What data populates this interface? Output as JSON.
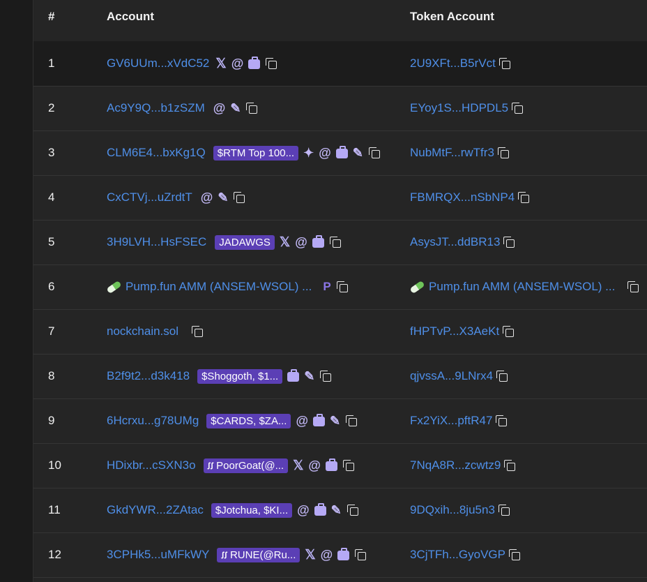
{
  "columns": {
    "num": "#",
    "account": "Account",
    "token": "Token Account"
  },
  "icons": {
    "x": "𝕏",
    "at": "@",
    "p": "P",
    "sparkle": "✦",
    "pencil": "✎",
    "copy": "copy-icon",
    "bag": "briefcase-icon",
    "pill": "pill-icon",
    "tag_prefix": "ꭍꭍ"
  },
  "colors": {
    "link": "#4f8fe8",
    "tag_bg": "#5b3fb5",
    "icon": "#b5a9f5"
  },
  "rows": [
    {
      "num": "1",
      "account": "GV6UUm...xVdC52",
      "token": "2U9XFt...B5rVct"
    },
    {
      "num": "2",
      "account": "Ac9Y9Q...b1zSZM",
      "token": "EYoy1S...HDPDL5"
    },
    {
      "num": "3",
      "account": "CLM6E4...bxKg1Q",
      "tag": "$RTM Top 100...",
      "token": "NubMtF...rwTfr3"
    },
    {
      "num": "4",
      "account": "CxCTVj...uZrdtT",
      "token": "FBMRQX...nSbNP4"
    },
    {
      "num": "5",
      "account": "3H9LVH...HsFSEC",
      "tag": "JADAWGS",
      "token": "AsysJT...ddBR13"
    },
    {
      "num": "6",
      "account": "Pump.fun AMM (ANSEM-WSOL) ...",
      "token": "Pump.fun AMM (ANSEM-WSOL) ..."
    },
    {
      "num": "7",
      "account": "nockchain.sol",
      "token": "fHPTvP...X3AeKt"
    },
    {
      "num": "8",
      "account": "B2f9t2...d3k418",
      "tag": "$Shoggoth, $1...",
      "token": "qjvssA...9LNrx4"
    },
    {
      "num": "9",
      "account": "6Hcrxu...g78UMg",
      "tag": "$CARDS, $ZA...",
      "token": "Fx2YiX...pftR47"
    },
    {
      "num": "10",
      "account": "HDixbr...cSXN3o",
      "tag": "PoorGoat(@...",
      "token": "7NqA8R...zcwtz9"
    },
    {
      "num": "11",
      "account": "GkdYWR...2ZAtac",
      "tag": "$Jotchua, $KI...",
      "token": "9DQxih...8ju5n3"
    },
    {
      "num": "12",
      "account": "3CPHk5...uMFkWY",
      "tag": "RUNE(@Ru...",
      "token": "3CjTFh...GyoVGP"
    }
  ]
}
